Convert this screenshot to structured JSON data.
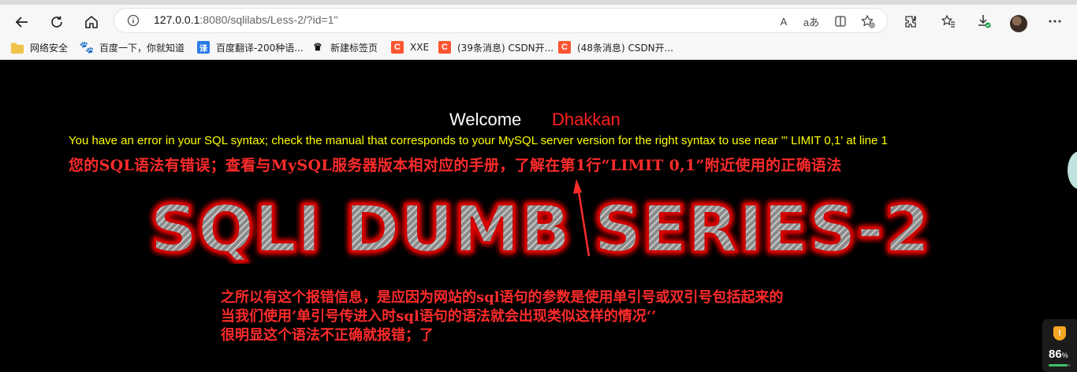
{
  "browser": {
    "url_host": "127.0.0.1",
    "url_rest": ":8080/sqlilabs/Less-2/?id=1\"",
    "read_aloud_label": "A",
    "translate_label": "aあ"
  },
  "bookmarks": [
    {
      "label": "网络安全",
      "icon": "folder-icon"
    },
    {
      "label": "百度一下，你就知道",
      "icon": "baidu-icon"
    },
    {
      "label": "百度翻译-200种语...",
      "icon": "translate-icon"
    },
    {
      "label": "新建标签页",
      "icon": "crown-icon"
    },
    {
      "label": "XXE",
      "icon": "csdn-icon"
    },
    {
      "label": "(39条消息) CSDN开...",
      "icon": "csdn-icon"
    },
    {
      "label": "(48条消息) CSDN开...",
      "icon": "csdn-icon"
    }
  ],
  "page": {
    "welcome": "Welcome",
    "welcome_name": "Dhakkan",
    "sql_error": "You have an error in your SQL syntax; check the manual that corresponds to your MySQL server version for the right syntax to use near '\" LIMIT 0,1' at line 1",
    "sql_error_cn": "您的SQL语法有错误；查看与MySQL服务器版本相对应的手册，了解在第1行“LIMIT 0,1”附近使用的正确语法",
    "banner_text": "SQLI DUMB SERIES-2",
    "notes": [
      "之所以有这个报错信息，是应因为网站的sql语句的参数是使用单引号或双引号包括起来的",
      "当我们使用’单引号传进入时sql语句的语法就会出现类似这样的情况‘’",
      "很明显这个语法不正确就报错；了"
    ]
  },
  "perf_widget": {
    "value": "86",
    "unit": "%",
    "level": 0.86
  },
  "colors": {
    "error_yellow": "#ffff00",
    "annotation_red": "#ff2b2b",
    "name_red": "#ff2020",
    "banner_glow": "#ff0000"
  }
}
